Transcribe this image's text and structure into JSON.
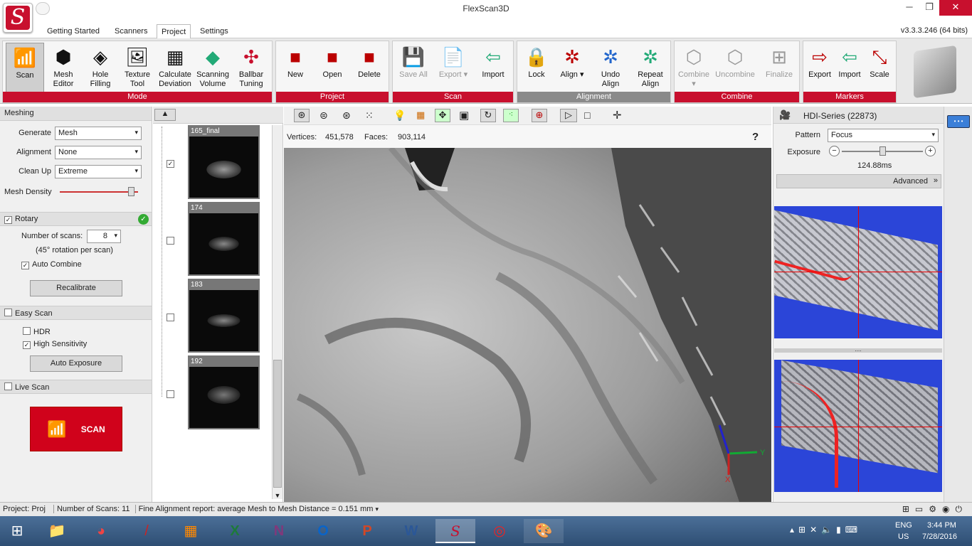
{
  "window": {
    "title": "FlexScan3D",
    "version": "v3.3.3.246  (64 bits)"
  },
  "tabs": [
    "Getting Started",
    "Scanners",
    "Project",
    "Settings"
  ],
  "active_tab": "Project",
  "ribbon": {
    "mode": {
      "label": "Mode",
      "buttons": [
        "Scan",
        "Mesh\nEditor",
        "Hole\nFilling",
        "Texture\nTool",
        "Calculate\nDeviation",
        "Scanning\nVolume",
        "Ballbar\nTuning"
      ]
    },
    "project": {
      "label": "Project",
      "buttons": [
        "New",
        "Open",
        "Delete"
      ]
    },
    "scan": {
      "label": "Scan",
      "buttons": [
        "Save All",
        "Export ▾",
        "Import"
      ]
    },
    "alignment": {
      "label": "Alignment",
      "buttons": [
        "Lock",
        "Align ▾",
        "Undo\nAlign",
        "Repeat\nAlign"
      ]
    },
    "combine": {
      "label": "Combine",
      "buttons": [
        "Combine\n▾",
        "Uncombine",
        "Finalize"
      ]
    },
    "markers": {
      "label": "Markers",
      "buttons": [
        "Export",
        "Import",
        "Scale"
      ]
    }
  },
  "meshing": {
    "title": "Meshing",
    "generate_label": "Generate",
    "generate": "Mesh",
    "alignment_label": "Alignment",
    "alignment": "None",
    "cleanup_label": "Clean Up",
    "cleanup": "Extreme",
    "density_label": "Mesh Density",
    "density_value": 0.95
  },
  "rotary": {
    "title": "Rotary",
    "enabled": true,
    "num_label": "Number of scans:",
    "num": "8",
    "note": "(45° rotation per scan)",
    "auto_combine": "Auto Combine",
    "recalibrate": "Recalibrate"
  },
  "easy_scan": {
    "title": "Easy Scan",
    "hdr": "HDR",
    "high_sens": "High Sensitivity",
    "auto_exposure": "Auto Exposure"
  },
  "live_scan": {
    "title": "Live Scan",
    "scan_button": "SCAN"
  },
  "scans": [
    {
      "name": "165_final",
      "checked": true
    },
    {
      "name": "174",
      "checked": false
    },
    {
      "name": "183",
      "checked": false
    },
    {
      "name": "192",
      "checked": false
    }
  ],
  "viewport": {
    "vertices_label": "Vertices:",
    "vertices": "451,578",
    "faces_label": "Faces:",
    "faces": "903,114",
    "help": "?",
    "axis_y": "Y",
    "axis_x": "X"
  },
  "camera": {
    "title": "HDI-Series (22873)",
    "pattern_label": "Pattern",
    "pattern": "Focus",
    "exposure_label": "Exposure",
    "exposure": "124.88ms",
    "exposure_value": 0.5,
    "advanced": "Advanced"
  },
  "status": {
    "project": "Project:  Proj",
    "num_scans": "Number of Scans:  11",
    "report": "Fine Alignment report: average Mesh to Mesh Distance = 0.151 mm"
  },
  "taskbar": {
    "lang": "ENG",
    "region": "US",
    "time": "3:44 PM",
    "date": "7/28/2016"
  },
  "colors": {
    "accent": "#c8102e",
    "scan_button": "#d0021b",
    "taskbar": "#3a5d85"
  }
}
